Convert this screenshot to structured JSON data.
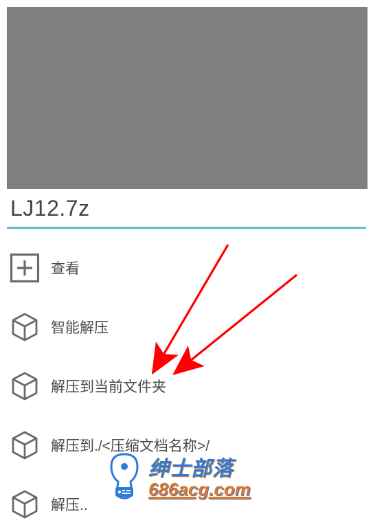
{
  "filename": "LJ12.7z",
  "menu": {
    "items": [
      {
        "icon": "plus-box",
        "label": "查看"
      },
      {
        "icon": "cube",
        "label": "智能解压"
      },
      {
        "icon": "cube",
        "label": "解压到当前文件夹"
      },
      {
        "icon": "cube",
        "label": "解压到./<压缩文档名称>/"
      },
      {
        "icon": "cube",
        "label": "解压.."
      }
    ]
  },
  "watermark": {
    "line1": "绅士部落",
    "line2": "686acg.com"
  }
}
